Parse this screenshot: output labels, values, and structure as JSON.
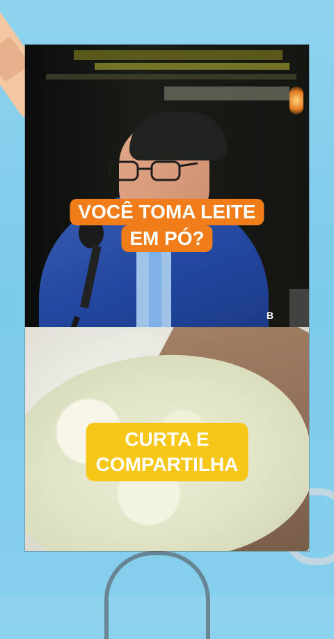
{
  "captions": {
    "top_line1": "VOCÊ TOMA LEITE",
    "top_line2": "EM PÓ?",
    "bottom_line1": "CURTA E",
    "bottom_line2": "COMPARTILHA"
  },
  "watermark": "B",
  "colors": {
    "background": "#8fd3ee",
    "caption_top_bg": "#f07c1a",
    "caption_bottom_bg": "#f6c619",
    "caption_text": "#ffffff"
  }
}
